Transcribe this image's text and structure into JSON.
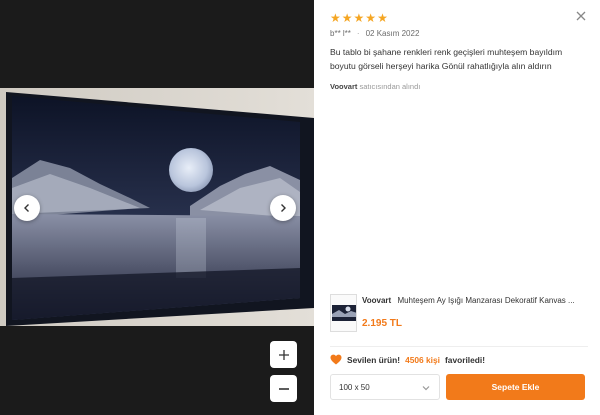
{
  "review": {
    "rating": 5,
    "author": "b** l**",
    "date": "02 Kasım 2022",
    "text": "Bu tablo bi şahane renkleri renk geçişleri muhteşem bayıldım boyutu görseli herşeyi harika Gönül rahatlığıyla alın aldırın",
    "seller_name": "Voovart",
    "seller_suffix": "satıcısından alındı"
  },
  "product": {
    "brand": "Voovart",
    "title": "Muhteşem Ay Işığı Manzarası Dekoratif Kanvas ...",
    "price": "2.195 TL"
  },
  "favorites": {
    "prefix": "Sevilen ürün!",
    "count": "4506 kişi",
    "suffix": "favoriledi!"
  },
  "size_select": {
    "selected": "100 x 50"
  },
  "cart_button": {
    "label": "Sepete Ekle"
  },
  "icons": {
    "star": "star-icon",
    "close": "close-icon",
    "prev": "chevron-left-icon",
    "next": "chevron-right-icon",
    "zoom_in": "plus-icon",
    "zoom_out": "minus-icon",
    "heart": "heart-icon",
    "dropdown": "chevron-down-icon"
  },
  "colors": {
    "accent": "#f27a1a",
    "star": "#f5a623",
    "viewer_bg": "#1b1b1b"
  }
}
